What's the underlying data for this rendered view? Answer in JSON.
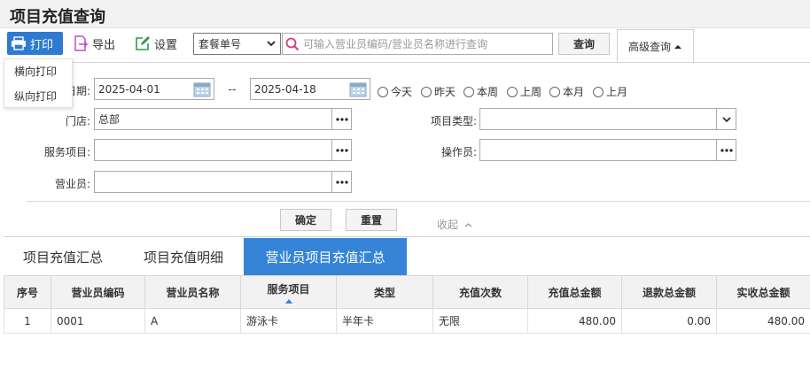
{
  "page": {
    "title": "项目充值查询"
  },
  "toolbar": {
    "print_label": "打印",
    "export_label": "导出",
    "settings_label": "设置",
    "search_type_value": "套餐单号",
    "search_placeholder": "可输入营业员编码/营业员名称进行查询",
    "query_label": "查询",
    "advanced_label": "高级查询"
  },
  "print_menu": {
    "items": [
      {
        "label": "横向打印"
      },
      {
        "label": "纵向打印"
      }
    ]
  },
  "filters": {
    "date_label": "日期:",
    "date_from": "2025-04-01",
    "date_sep": "--",
    "date_to": "2025-04-18",
    "quick_ranges": [
      {
        "label": "今天"
      },
      {
        "label": "昨天"
      },
      {
        "label": "本周"
      },
      {
        "label": "上周"
      },
      {
        "label": "本月"
      },
      {
        "label": "上月"
      }
    ],
    "store_label": "门店:",
    "store_value": "总部",
    "item_type_label": "项目类型:",
    "item_type_value": "",
    "service_label": "服务项目:",
    "service_value": "",
    "operator_label": "操作员:",
    "operator_value": "",
    "salesperson_label": "营业员:",
    "salesperson_value": "",
    "confirm_label": "确定",
    "reset_label": "重置",
    "collapse_label": "收起"
  },
  "tabs": [
    {
      "label": "项目充值汇总"
    },
    {
      "label": "项目充值明细"
    },
    {
      "label": "营业员项目充值汇总"
    }
  ],
  "table": {
    "columns": [
      "序号",
      "营业员编码",
      "营业员名称",
      "服务项目",
      "类型",
      "充值次数",
      "充值总金额",
      "退款总金额",
      "实收总金额"
    ],
    "rows": [
      [
        "1",
        "0001",
        "A",
        "游泳卡",
        "半年卡",
        "无限",
        "480.00",
        "0.00",
        "480.00"
      ]
    ]
  },
  "colors": {
    "accent": "#3584d8",
    "print_button": "#2d7ad0"
  }
}
